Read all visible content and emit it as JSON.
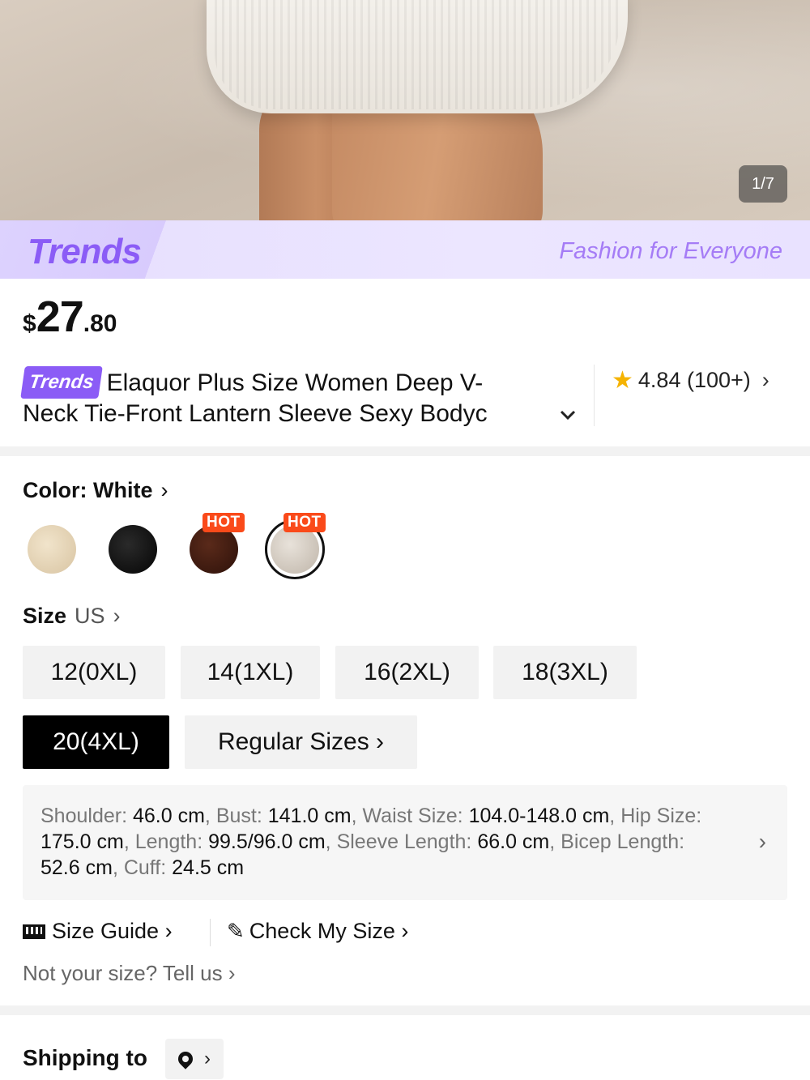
{
  "hero": {
    "image_counter": "1/7"
  },
  "banner": {
    "logo": "Trends",
    "slogan": "Fashion for Everyone"
  },
  "price": {
    "currency": "$",
    "integer": "27",
    "decimal": ".80"
  },
  "product": {
    "badge": "Trends",
    "title_line1": "Elaquor Plus Size Women Deep V-",
    "title_line2": "Neck Tie-Front Lantern Sleeve Sexy Bodyc",
    "expand_icon": "chevron-down-icon"
  },
  "rating": {
    "score": "4.84",
    "count": "(100+)",
    "chevron": "›"
  },
  "color": {
    "label": "Color: White",
    "chevron": "›",
    "hot_badge": "HOT",
    "swatches": [
      {
        "name": "beige",
        "color": "#e4d3b4",
        "hot": false
      },
      {
        "name": "black",
        "color": "#111111",
        "hot": false
      },
      {
        "name": "brown",
        "color": "#3e1a0f",
        "hot": true
      },
      {
        "name": "white",
        "color": "#d8d0c6",
        "hot": true,
        "selected": true
      }
    ]
  },
  "size": {
    "label": "Size",
    "unit": "US",
    "chevron": "›",
    "options": [
      "12(0XL)",
      "14(1XL)",
      "16(2XL)",
      "18(3XL)",
      "20(4XL)"
    ],
    "selected": "20(4XL)",
    "regular_sizes": "Regular Sizes ›"
  },
  "measurements": {
    "shoulder_label": "Shoulder:",
    "shoulder": "46.0 cm",
    "bust_label": "Bust:",
    "bust": "141.0 cm",
    "waist_label": "Waist Size:",
    "waist": "104.0-148.0 cm",
    "hip_label": "Hip Size:",
    "hip": "175.0 cm",
    "length_label": "Length:",
    "length": "99.5/96.0 cm",
    "sleeve_label": "Sleeve Length:",
    "sleeve": "66.0 cm",
    "bicep_label": "Bicep Length:",
    "bicep": "52.6 cm",
    "cuff_label": "Cuff:",
    "cuff": "24.5 cm",
    "chevron": "›"
  },
  "guide": {
    "size_guide": "Size Guide ›",
    "check_size": "Check My Size ›",
    "not_your_size": "Not your size? Tell us ›"
  },
  "shipping": {
    "label": "Shipping to",
    "chevron": "›"
  }
}
